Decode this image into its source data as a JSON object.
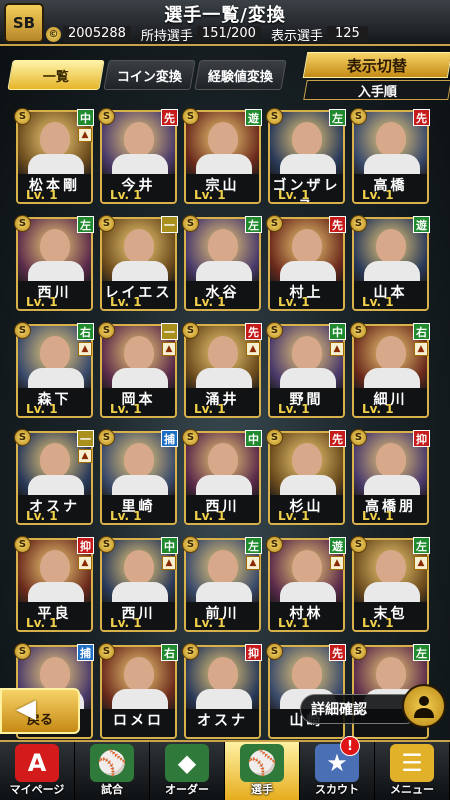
{
  "header": {
    "title": "選手一覧/変換",
    "logo": "SB",
    "coin_symbol": "©",
    "coins": "2005288",
    "owned_label": "所持選手",
    "owned_value": "151/200",
    "display_label": "表示選手",
    "display_value": "125"
  },
  "tabs": [
    {
      "label": "一覧",
      "active": true
    },
    {
      "label": "コイン変換",
      "active": false
    },
    {
      "label": "経験値変換",
      "active": false
    }
  ],
  "display_toggle": {
    "label": "表示切替",
    "sort": "入手順"
  },
  "players": [
    {
      "name": "松本剛",
      "level": "Lv. 1",
      "position": "中",
      "pos_color": "#1f8a2e",
      "upgrade": true
    },
    {
      "name": "今井",
      "level": "Lv. 1",
      "position": "先",
      "pos_color": "#c51b1b",
      "upgrade": false
    },
    {
      "name": "宗山",
      "level": "Lv. 1",
      "position": "遊",
      "pos_color": "#1f8a2e",
      "upgrade": false
    },
    {
      "name": "ゴンザレス",
      "level": "Lv. 1",
      "position": "左",
      "pos_color": "#1f8a2e",
      "upgrade": false
    },
    {
      "name": "高橋",
      "level": "Lv. 1",
      "position": "先",
      "pos_color": "#c51b1b",
      "upgrade": false
    },
    {
      "name": "西川",
      "level": "Lv. 1",
      "position": "左",
      "pos_color": "#1f8a2e",
      "upgrade": false
    },
    {
      "name": "レイエス",
      "level": "Lv. 1",
      "position": "一",
      "pos_color": "#a98f1c",
      "upgrade": false
    },
    {
      "name": "水谷",
      "level": "Lv. 1",
      "position": "左",
      "pos_color": "#1f8a2e",
      "upgrade": false
    },
    {
      "name": "村上",
      "level": "Lv. 1",
      "position": "先",
      "pos_color": "#c51b1b",
      "upgrade": false
    },
    {
      "name": "山本",
      "level": "Lv. 1",
      "position": "遊",
      "pos_color": "#1f8a2e",
      "upgrade": false
    },
    {
      "name": "森下",
      "level": "Lv. 1",
      "position": "右",
      "pos_color": "#1f8a2e",
      "upgrade": true
    },
    {
      "name": "岡本",
      "level": "Lv. 1",
      "position": "一",
      "pos_color": "#a98f1c",
      "upgrade": true
    },
    {
      "name": "涌井",
      "level": "Lv. 1",
      "position": "先",
      "pos_color": "#c51b1b",
      "upgrade": true
    },
    {
      "name": "野間",
      "level": "Lv. 1",
      "position": "中",
      "pos_color": "#1f8a2e",
      "upgrade": true
    },
    {
      "name": "細川",
      "level": "Lv. 1",
      "position": "右",
      "pos_color": "#1f8a2e",
      "upgrade": true
    },
    {
      "name": "オスナ",
      "level": "Lv. 1",
      "position": "一",
      "pos_color": "#a98f1c",
      "upgrade": true
    },
    {
      "name": "里崎",
      "level": "Lv. 1",
      "position": "捕",
      "pos_color": "#1f6fc5",
      "upgrade": false
    },
    {
      "name": "西川",
      "level": "Lv. 1",
      "position": "中",
      "pos_color": "#1f8a2e",
      "upgrade": false
    },
    {
      "name": "杉山",
      "level": "Lv. 1",
      "position": "先",
      "pos_color": "#c51b1b",
      "upgrade": false
    },
    {
      "name": "高橋朋",
      "level": "Lv. 1",
      "position": "抑",
      "pos_color": "#c51b1b",
      "upgrade": false
    },
    {
      "name": "平良",
      "level": "Lv. 1",
      "position": "抑",
      "pos_color": "#c51b1b",
      "upgrade": true
    },
    {
      "name": "西川",
      "level": "Lv. 1",
      "position": "中",
      "pos_color": "#1f8a2e",
      "upgrade": true
    },
    {
      "name": "前川",
      "level": "Lv. 1",
      "position": "左",
      "pos_color": "#1f8a2e",
      "upgrade": true
    },
    {
      "name": "村林",
      "level": "Lv. 1",
      "position": "遊",
      "pos_color": "#1f8a2e",
      "upgrade": true
    },
    {
      "name": "末包",
      "level": "Lv. 1",
      "position": "左",
      "pos_color": "#1f8a2e",
      "upgrade": true
    },
    {
      "name": "",
      "level": "",
      "position": "捕",
      "pos_color": "#1f6fc5",
      "upgrade": false
    },
    {
      "name": "ロメロ",
      "level": "",
      "position": "右",
      "pos_color": "#1f8a2e",
      "upgrade": false
    },
    {
      "name": "オスナ",
      "level": "",
      "position": "抑",
      "pos_color": "#c51b1b",
      "upgrade": false
    },
    {
      "name": "山崎",
      "level": "",
      "position": "先",
      "pos_color": "#c51b1b",
      "upgrade": false
    },
    {
      "name": "",
      "level": "",
      "position": "左",
      "pos_color": "#1f8a2e",
      "upgrade": false
    }
  ],
  "back_button": {
    "label": "戻る"
  },
  "detail_button": {
    "label": "詳細確認"
  },
  "nav": [
    {
      "label": "マイページ",
      "icon": "A",
      "active": false,
      "badge": ""
    },
    {
      "label": "試合",
      "icon": "⚾",
      "active": false,
      "badge": ""
    },
    {
      "label": "オーダー",
      "icon": "◆",
      "active": false,
      "badge": ""
    },
    {
      "label": "選手",
      "icon": "⚾",
      "active": true,
      "badge": ""
    },
    {
      "label": "スカウト",
      "icon": "★",
      "active": false,
      "badge": "!"
    },
    {
      "label": "メニュー",
      "icon": "☰",
      "active": false,
      "badge": ""
    }
  ],
  "colors": {
    "gold": "#d9b14a",
    "accent": "#e6b52a"
  }
}
